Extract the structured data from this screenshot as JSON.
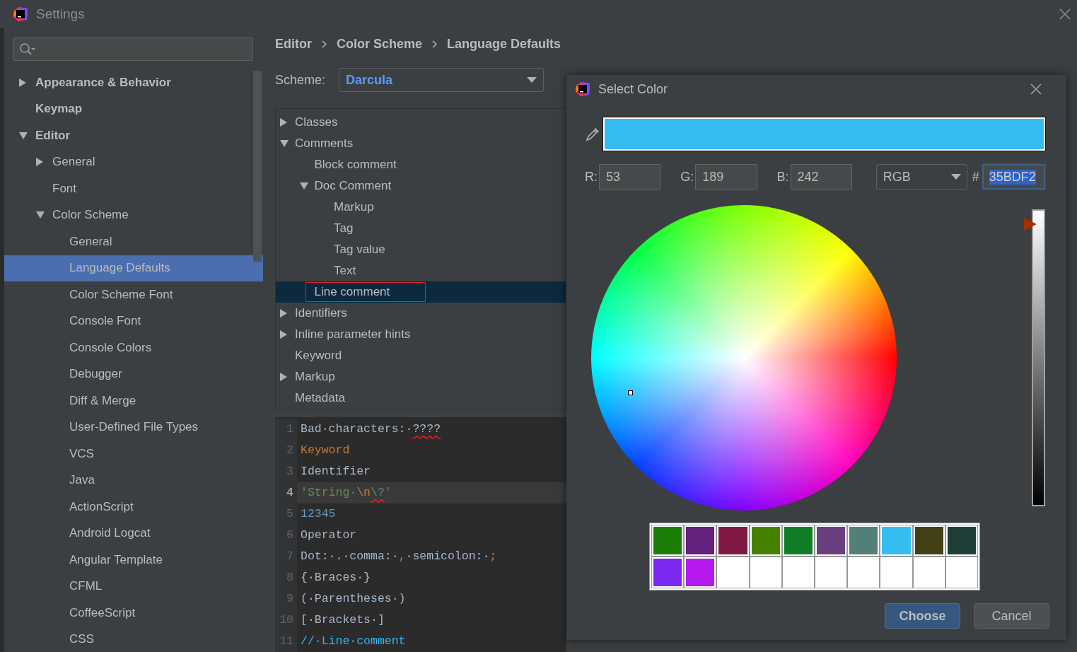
{
  "window": {
    "title": "Settings"
  },
  "sidebar": {
    "items": [
      {
        "label": "Appearance & Behavior",
        "expanded": false,
        "selected": false
      },
      {
        "label": "Keymap",
        "selected": false
      },
      {
        "label": "Editor",
        "expanded": true,
        "selected": false,
        "children": [
          {
            "label": "General",
            "expanded": false,
            "selected": false
          },
          {
            "label": "Font",
            "selected": false
          },
          {
            "label": "Color Scheme",
            "expanded": true,
            "selected": false,
            "children": [
              {
                "label": "General",
                "selected": false
              },
              {
                "label": "Language Defaults",
                "selected": true
              },
              {
                "label": "Color Scheme Font",
                "selected": false
              },
              {
                "label": "Console Font",
                "selected": false
              },
              {
                "label": "Console Colors",
                "selected": false
              },
              {
                "label": "Debugger",
                "selected": false
              },
              {
                "label": "Diff & Merge",
                "selected": false
              },
              {
                "label": "User-Defined File Types",
                "selected": false
              },
              {
                "label": "VCS",
                "selected": false
              },
              {
                "label": "Java",
                "selected": false
              },
              {
                "label": "ActionScript",
                "selected": false
              },
              {
                "label": "Android Logcat",
                "selected": false
              },
              {
                "label": "Angular Template",
                "selected": false
              },
              {
                "label": "CFML",
                "selected": false
              },
              {
                "label": "CoffeeScript",
                "selected": false
              },
              {
                "label": "CSS",
                "selected": false
              }
            ]
          }
        ]
      }
    ]
  },
  "breadcrumbs": [
    "Editor",
    "Color Scheme",
    "Language Defaults"
  ],
  "scheme": {
    "label": "Scheme:",
    "value": "Darcula"
  },
  "elements": [
    {
      "label": "Classes",
      "expanded": false,
      "selected": false
    },
    {
      "label": "Comments",
      "expanded": true,
      "selected": false,
      "children": [
        {
          "label": "Block comment",
          "selected": false
        },
        {
          "label": "Doc Comment",
          "expanded": true,
          "selected": false,
          "children": [
            {
              "label": "Markup",
              "selected": false
            },
            {
              "label": "Tag",
              "selected": false
            },
            {
              "label": "Tag value",
              "selected": false
            },
            {
              "label": "Text",
              "selected": false
            }
          ]
        },
        {
          "label": "Line comment",
          "selected": true
        }
      ]
    },
    {
      "label": "Identifiers",
      "expanded": false,
      "selected": false
    },
    {
      "label": "Inline parameter hints",
      "expanded": false,
      "selected": false
    },
    {
      "label": "Keyword",
      "selected": false
    },
    {
      "label": "Markup",
      "expanded": false,
      "selected": false
    },
    {
      "label": "Metadata",
      "selected": false
    }
  ],
  "code_preview": {
    "lines": [
      {
        "number": "1",
        "current": false,
        "tokens": [
          {
            "text": "Bad·characters:·",
            "kind": "plain"
          },
          {
            "text": "????",
            "kind": "error"
          }
        ]
      },
      {
        "number": "2",
        "current": false,
        "tokens": [
          {
            "text": "Keyword",
            "kind": "keyword"
          }
        ]
      },
      {
        "number": "3",
        "current": false,
        "tokens": [
          {
            "text": "Identifier",
            "kind": "plain"
          }
        ]
      },
      {
        "number": "4",
        "current": true,
        "tokens": [
          {
            "text": "'String·",
            "kind": "string"
          },
          {
            "text": "\\n",
            "kind": "keyword"
          },
          {
            "text": "\\?",
            "kind": "error-string"
          },
          {
            "text": "'",
            "kind": "string"
          }
        ]
      },
      {
        "number": "5",
        "current": false,
        "tokens": [
          {
            "text": "12345",
            "kind": "number"
          }
        ]
      },
      {
        "number": "6",
        "current": false,
        "tokens": [
          {
            "text": "Operator",
            "kind": "plain"
          }
        ]
      },
      {
        "number": "7",
        "current": false,
        "tokens": [
          {
            "text": "Dot:·.·comma:·",
            "kind": "plain"
          },
          {
            "text": ",",
            "kind": "keyword"
          },
          {
            "text": "·semicolon:·",
            "kind": "plain"
          },
          {
            "text": ";",
            "kind": "keyword"
          }
        ]
      },
      {
        "number": "8",
        "current": false,
        "tokens": [
          {
            "text": "{·Braces·}",
            "kind": "plain"
          }
        ]
      },
      {
        "number": "9",
        "current": false,
        "tokens": [
          {
            "text": "(·Parentheses·)",
            "kind": "plain"
          }
        ]
      },
      {
        "number": "10",
        "current": false,
        "tokens": [
          {
            "text": "[·Brackets·]",
            "kind": "plain"
          }
        ]
      },
      {
        "number": "11",
        "current": false,
        "tokens": [
          {
            "text": "//·Line·comment",
            "kind": "comment"
          }
        ]
      }
    ]
  },
  "dialog": {
    "title": "Select Color",
    "preview": {
      "color": "#35bdf2"
    },
    "fields": [
      {
        "label": "R:",
        "value": "53"
      },
      {
        "label": "G:",
        "value": "189"
      },
      {
        "label": "B:",
        "value": "242"
      }
    ],
    "mode": "RGB",
    "hex_label": "#",
    "hex": "35BDF2",
    "hex_selected": true,
    "brightness": {
      "level": 0.95
    },
    "recent_colors": [
      {
        "color": "#1a7d06"
      },
      {
        "color": "#64217d"
      },
      {
        "color": "#7f1843"
      },
      {
        "color": "#468200"
      },
      {
        "color": "#117e27"
      },
      {
        "color": "#6a3f7e"
      },
      {
        "color": "#51807a"
      },
      {
        "color": "#35bdf2"
      },
      {
        "color": "#433f16"
      },
      {
        "color": "#1e3e37"
      },
      {
        "color": "#7b28f0"
      },
      {
        "color": "#b618f0"
      },
      {
        "color": "#ffffff"
      },
      {
        "color": "#ffffff"
      },
      {
        "color": "#ffffff"
      },
      {
        "color": "#ffffff"
      },
      {
        "color": "#ffffff"
      },
      {
        "color": "#ffffff"
      },
      {
        "color": "#ffffff"
      },
      {
        "color": "#ffffff"
      }
    ],
    "buttons": [
      {
        "label": "Choose",
        "default": true
      },
      {
        "label": "Cancel",
        "default": false
      }
    ]
  }
}
